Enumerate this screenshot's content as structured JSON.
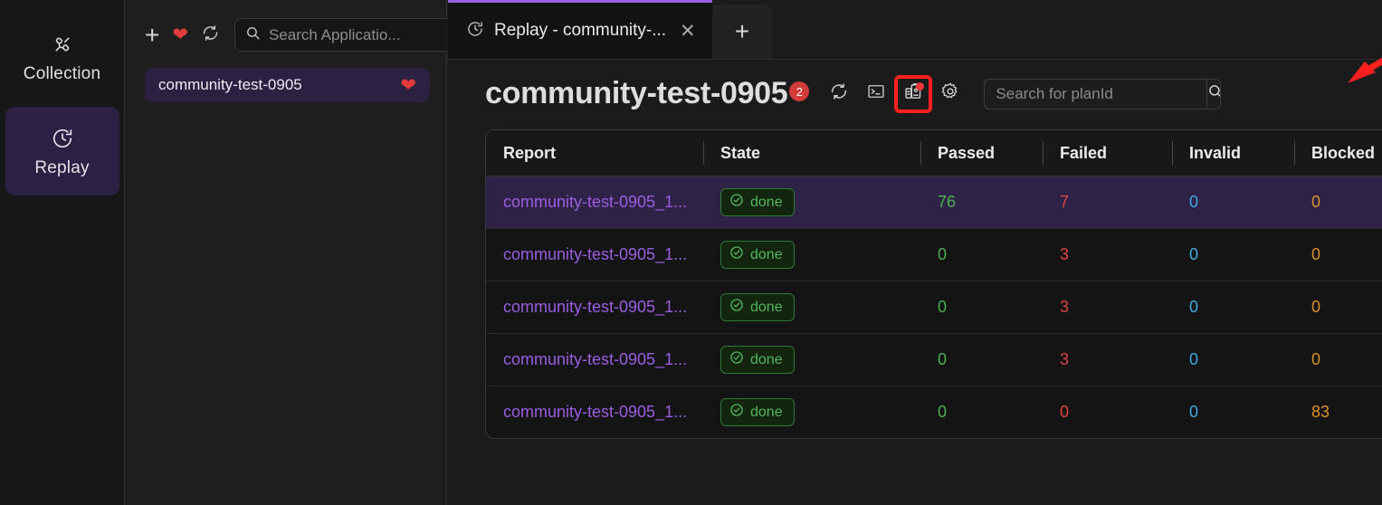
{
  "rail": {
    "items": [
      {
        "label": "Collection",
        "icon": "plug-icon",
        "active": false
      },
      {
        "label": "Replay",
        "icon": "clock-history-icon",
        "active": true
      }
    ]
  },
  "apps_panel": {
    "toolbar": {
      "add_label": "+",
      "favorite_icon": "heart-icon",
      "refresh_icon": "refresh-icon"
    },
    "search": {
      "value": "",
      "placeholder": "Search Applicatio..."
    },
    "items": [
      {
        "name": "community-test-0905",
        "favorite_icon": "heart-icon",
        "selected": true
      }
    ]
  },
  "tabs": {
    "items": [
      {
        "title": "Replay - community-...",
        "icon": "clock-history-icon",
        "close_label": "✕",
        "active": true
      }
    ],
    "new_tab_label": "+"
  },
  "header": {
    "title": "community-test-0905",
    "badge_count": "2",
    "icons": [
      {
        "name": "refresh-icon",
        "highlighted": false,
        "dot": false
      },
      {
        "name": "terminal-icon",
        "highlighted": false,
        "dot": false
      },
      {
        "name": "report-clipboard-icon",
        "highlighted": true,
        "dot": true
      },
      {
        "name": "gear-icon",
        "highlighted": false,
        "dot": false
      }
    ],
    "plan_search": {
      "value": "",
      "placeholder": "Search for planId",
      "button_icon": "search-icon"
    }
  },
  "table": {
    "columns": [
      "Report",
      "State",
      "Passed",
      "Failed",
      "Invalid",
      "Blocked"
    ],
    "rows": [
      {
        "report": "community-test-0905_1...",
        "state": "done",
        "passed": "76",
        "failed": "7",
        "invalid": "0",
        "blocked": "0",
        "selected": true
      },
      {
        "report": "community-test-0905_1...",
        "state": "done",
        "passed": "0",
        "failed": "3",
        "invalid": "0",
        "blocked": "0",
        "selected": false
      },
      {
        "report": "community-test-0905_1...",
        "state": "done",
        "passed": "0",
        "failed": "3",
        "invalid": "0",
        "blocked": "0",
        "selected": false
      },
      {
        "report": "community-test-0905_1...",
        "state": "done",
        "passed": "0",
        "failed": "3",
        "invalid": "0",
        "blocked": "0",
        "selected": false
      },
      {
        "report": "community-test-0905_1...",
        "state": "done",
        "passed": "0",
        "failed": "0",
        "invalid": "0",
        "blocked": "83",
        "selected": false
      }
    ]
  },
  "annotation": {
    "color": "#ff1f1f",
    "shape": "arrow-and-box",
    "target": "report-clipboard-icon"
  },
  "colors": {
    "accent_purple": "#9a5ee0",
    "selected_row": "#2e2346",
    "passed": "#4caf50",
    "failed": "#e04545",
    "invalid": "#3fa9e0",
    "blocked": "#d9902b",
    "badge_red": "#d33a3a"
  }
}
